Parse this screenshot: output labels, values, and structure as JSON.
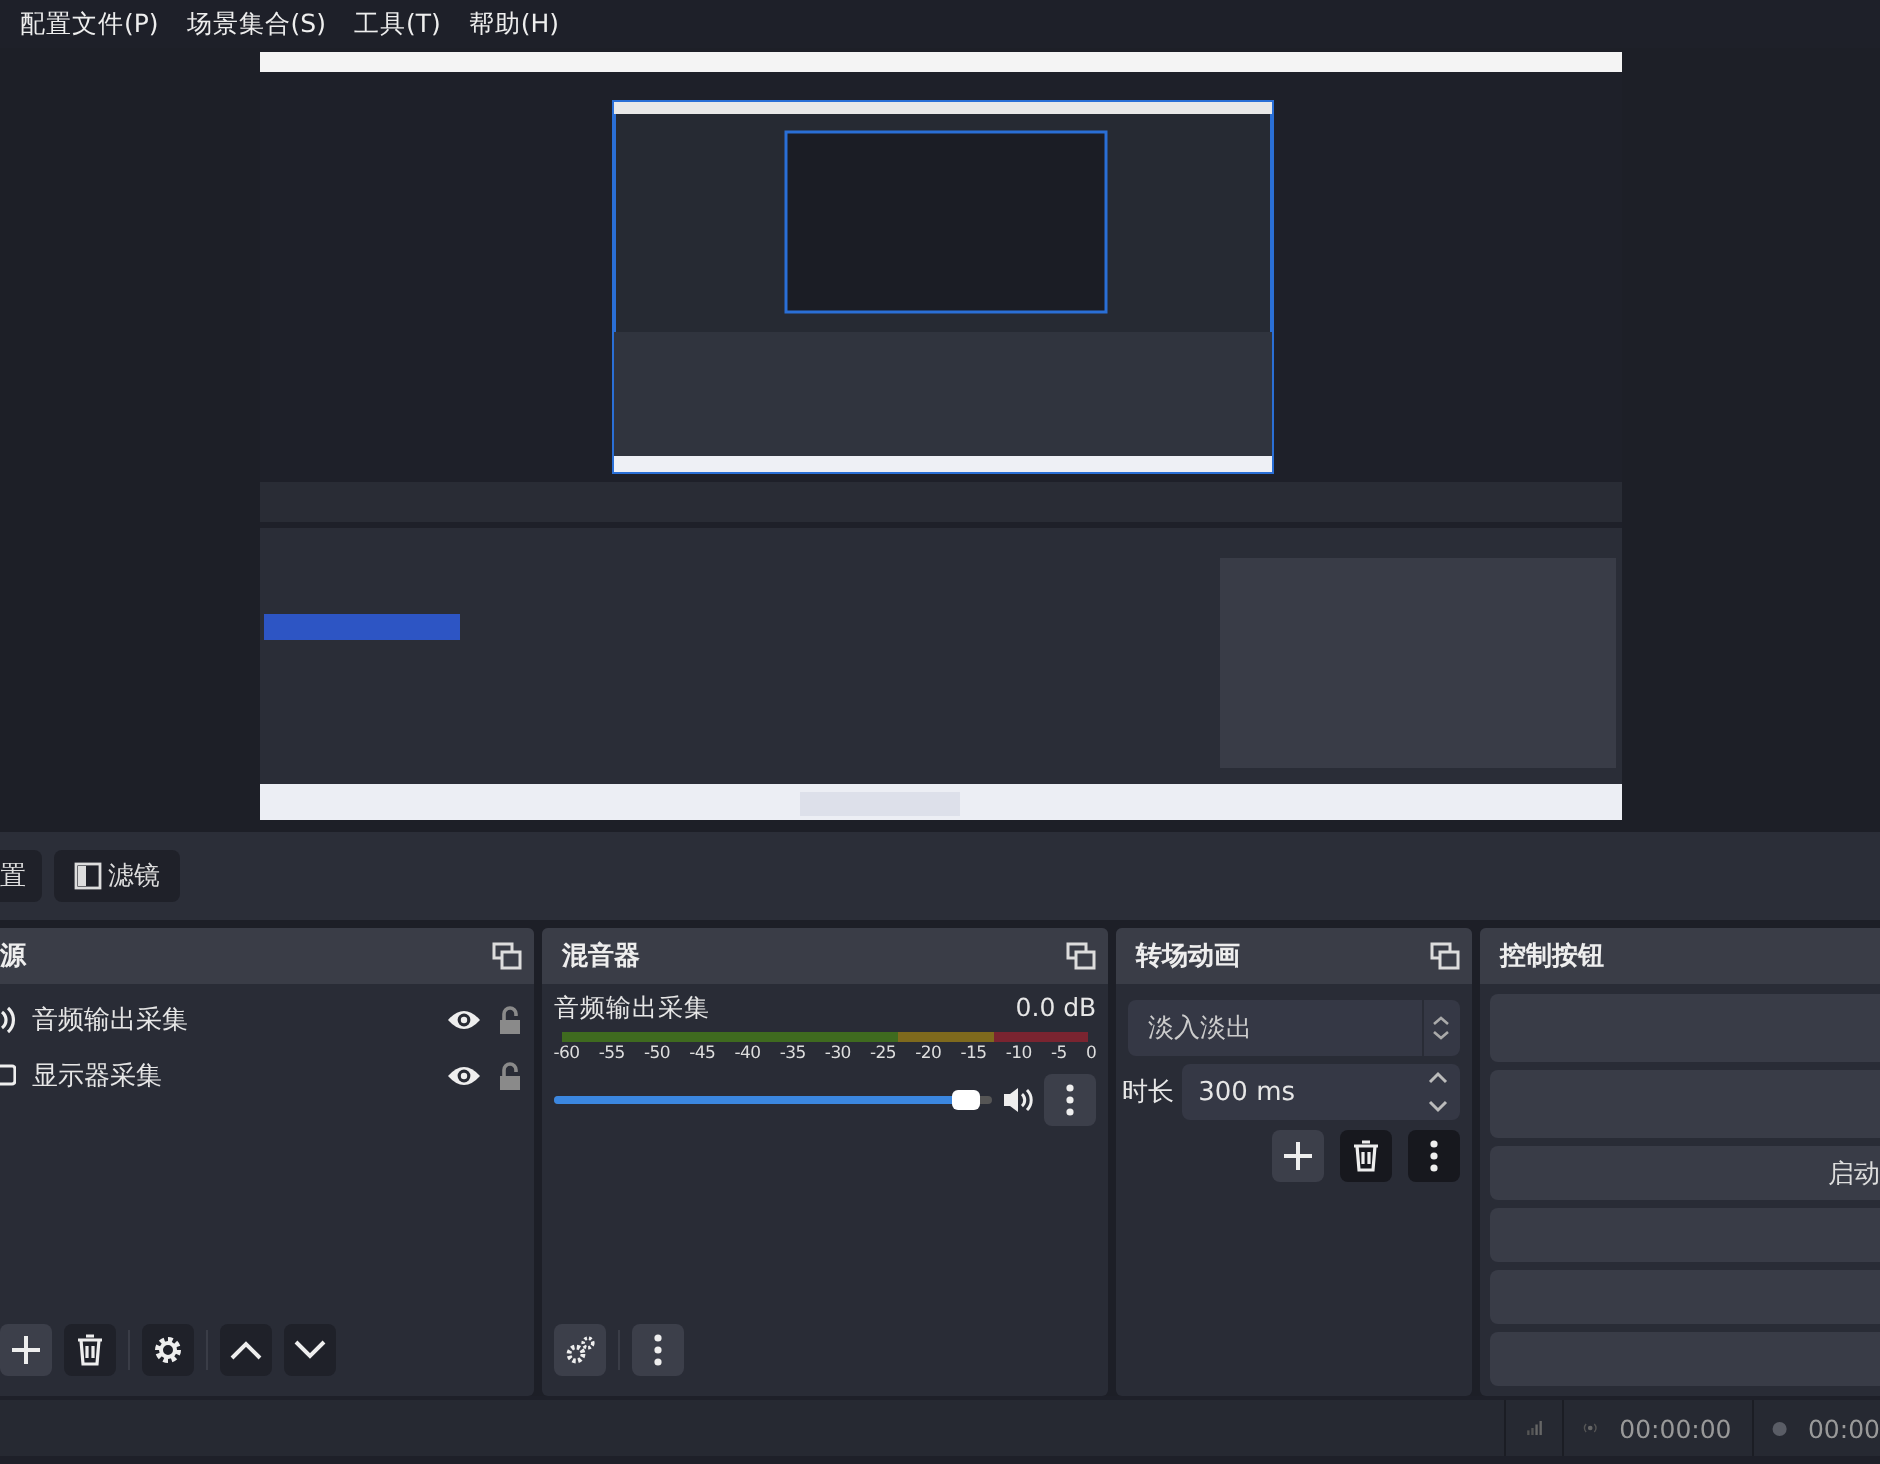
{
  "menu": [
    {
      "label": "配置文件(P)"
    },
    {
      "label": "场景集合(S)"
    },
    {
      "label": "工具(T)"
    },
    {
      "label": "帮助(H)"
    }
  ],
  "source_toolbar": [
    {
      "label": "置",
      "kind": "plain"
    },
    {
      "label": "滤镜",
      "kind": "filter"
    }
  ],
  "sources": {
    "title": "源",
    "items": [
      {
        "name": "音频输出采集",
        "kind": "audio",
        "visible": true,
        "locked": false
      },
      {
        "name": "显示器采集",
        "kind": "display",
        "visible": true,
        "locked": false
      }
    ]
  },
  "mixer": {
    "title": "混音器",
    "channels": [
      {
        "name": "音频输出采集",
        "reading": "0.0 dB",
        "level": 0.97,
        "muted": false
      }
    ],
    "scale": [
      "-60",
      "-55",
      "-50",
      "-45",
      "-40",
      "-35",
      "-30",
      "-25",
      "-20",
      "-15",
      "-10",
      "-5",
      "0"
    ]
  },
  "transitions": {
    "title": "转场动画",
    "selected": "淡入淡出",
    "duration_label": "时长",
    "duration": "300 ms"
  },
  "controls": {
    "title": "控制按钮",
    "buttons": [
      {
        "kind": "button"
      },
      {
        "kind": "button"
      },
      {
        "kind": "button",
        "label": "启动"
      },
      {
        "kind": "button"
      },
      {
        "kind": "button"
      },
      {
        "kind": "button"
      }
    ]
  },
  "status_bar": {
    "timers": [
      {
        "kind": "stream",
        "time": "00:00:00"
      },
      {
        "kind": "record",
        "time": "00:00"
      }
    ]
  }
}
